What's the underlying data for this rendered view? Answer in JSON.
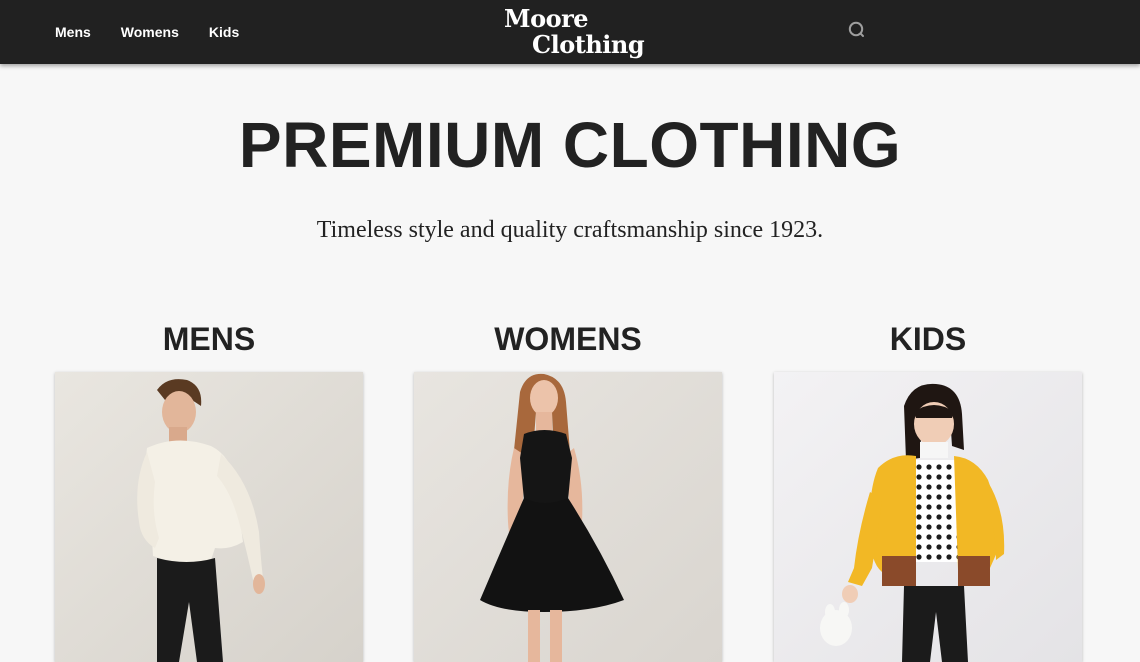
{
  "nav": {
    "items": [
      {
        "label": "Mens"
      },
      {
        "label": "Womens"
      },
      {
        "label": "Kids"
      }
    ]
  },
  "logo": {
    "line1": "Moore",
    "line2": "Clothing"
  },
  "search": {
    "icon": "search-icon"
  },
  "hero": {
    "title": "PREMIUM CLOTHING",
    "subtitle": "Timeless style and quality craftsmanship since 1923."
  },
  "categories": [
    {
      "title": "MENS",
      "image": "man-in-cream-sweater-photo"
    },
    {
      "title": "WOMENS",
      "image": "woman-in-black-dress-photo"
    },
    {
      "title": "KIDS",
      "image": "girl-in-yellow-jacket-photo"
    }
  ],
  "colors": {
    "header_bg": "#212121",
    "page_bg": "#f7f7f7",
    "text": "#222222"
  }
}
